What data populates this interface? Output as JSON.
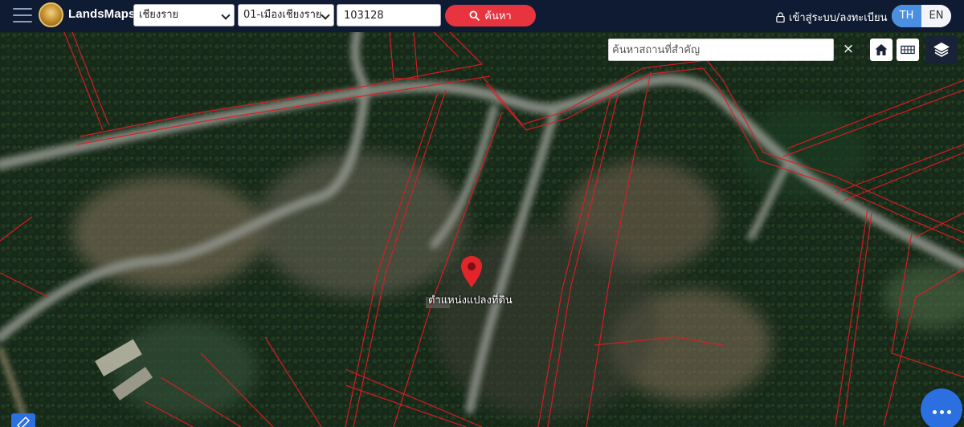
{
  "header": {
    "brand": "LandsMaps",
    "province_select": "เชียงราย",
    "district_select": "01-เมืองเชียงราย",
    "parcel_number": "103128",
    "search_label": "ค้นหา",
    "login_label": "เข้าสู่ระบบ/ลงทะเบียน",
    "lang_th": "TH",
    "lang_en": "EN"
  },
  "map": {
    "place_search_placeholder": "ค้นหาสถานที่สำคัญ",
    "clear_symbol": "×",
    "marker_label": "ตำแหน่งแปลงที่ดิน",
    "parcel_line_color": "#e01b24",
    "marker_color": "#e3242b"
  },
  "icons": [
    "menu-icon",
    "logo-icon",
    "search-icon",
    "lock-icon",
    "home-icon",
    "grid-icon",
    "layers-icon",
    "map-pin-icon",
    "chat-icon",
    "ruler-icon"
  ]
}
